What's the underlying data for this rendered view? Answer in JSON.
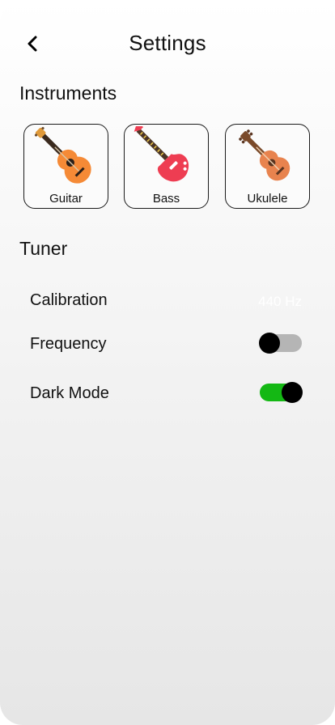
{
  "header": {
    "title": "Settings",
    "back_icon": "chevron-left-icon"
  },
  "instruments": {
    "title": "Instruments",
    "items": [
      {
        "label": "Guitar",
        "icon": "guitar-icon"
      },
      {
        "label": "Bass",
        "icon": "bass-guitar-icon"
      },
      {
        "label": "Ukulele",
        "icon": "ukulele-icon"
      }
    ]
  },
  "tuner": {
    "title": "Tuner",
    "calibration": {
      "label": "Calibration",
      "value": "440 Hz"
    },
    "frequency": {
      "label": "Frequency",
      "enabled": false
    },
    "dark_mode": {
      "label": "Dark Mode",
      "enabled": true
    }
  },
  "colors": {
    "toggle_on": "#14b814",
    "toggle_off": "#b5b5b5",
    "knob": "#000000"
  }
}
